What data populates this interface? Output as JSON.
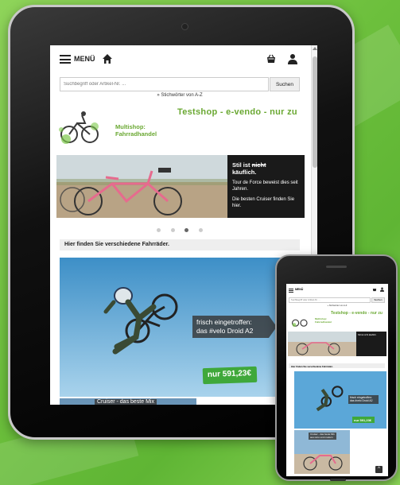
{
  "tablet": {
    "menu_label": "MENÜ",
    "search": {
      "placeholder": "Suchbegriff oder Artikel-Nr. ...",
      "button_label": "Suchen"
    },
    "az_link": "» Stichwörter von A-Z",
    "banner_text": "Testshop - e-vendo - nur zu",
    "logo_line1": "Multishop:",
    "logo_line2": "Fahrradhandel",
    "slider": {
      "heading_prefix": "Stil ist",
      "heading_strike": "nicht",
      "heading_suffix": "käuflich.",
      "p1": "Tour de Force beweist dies seit Jahren.",
      "p2": "Die besten Cruiser finden Sie hier."
    },
    "intro_text": "Hier finden Sie verschiedene Fahrräder.",
    "promo": {
      "line1": "frisch eingetroffen:",
      "line2": "das #velo Droid A2",
      "price": "nur 591,23€"
    },
    "cruiser_text": "Cruiser - das beste Mix"
  },
  "phone": {
    "menu_label": "MENÜ",
    "search_placeholder": "Suchbegriff oder Artikel-Nr. ...",
    "search_button": "Suchen",
    "az_link": "» Stichwörter von A-Z",
    "banner_text": "Testshop - e-vendo - nur zu",
    "logo_line1": "Multishop:",
    "logo_line2": "Fahrradhandel",
    "slider_text": "Stil ist nicht käuflich.",
    "intro_text": "Hier finden Sie verschiedene Fahrräder.",
    "promo_line1": "frisch eingetroffen:",
    "promo_line2": "das #velo Droid A2",
    "price": "nur 591,23€",
    "cruiser_line1": "Cruiser - das beste Mix",
    "cruiser_line2": "aus retro und modern",
    "to_top": "^"
  },
  "colors": {
    "brand_green": "#6aa832",
    "background": "#7cc84a",
    "price_green": "#3fa83a"
  }
}
